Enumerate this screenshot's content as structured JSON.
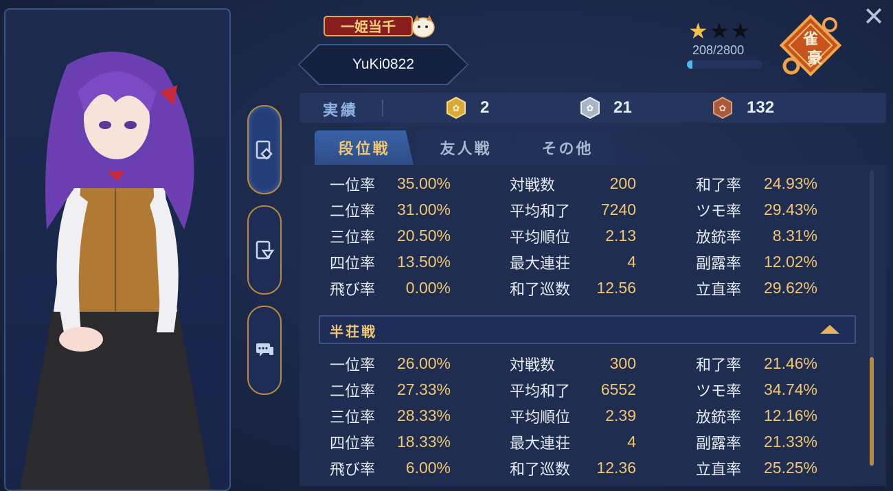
{
  "header": {
    "logo_text": "一姫当千",
    "player_name": "YuKi0822",
    "stars_filled": 1,
    "stars_total": 3,
    "exp_text": "208/2800",
    "exp_progress": 0.074,
    "rank_badge_text": "雀豪",
    "close_glyph": "✕"
  },
  "achievements": {
    "label": "実績",
    "gold": "2",
    "silver": "21",
    "bronze": "132"
  },
  "tabs": [
    {
      "label": "段位戦",
      "active": true
    },
    {
      "label": "友人戦",
      "active": false
    },
    {
      "label": "その他",
      "active": false
    }
  ],
  "section_east": {
    "col1": [
      {
        "label": "一位率",
        "value": "35.00%"
      },
      {
        "label": "二位率",
        "value": "31.00%"
      },
      {
        "label": "三位率",
        "value": "20.50%"
      },
      {
        "label": "四位率",
        "value": "13.50%"
      },
      {
        "label": "飛び率",
        "value": "0.00%"
      }
    ],
    "col2": [
      {
        "label": "対戦数",
        "value": "200"
      },
      {
        "label": "平均和了",
        "value": "7240"
      },
      {
        "label": "平均順位",
        "value": "2.13"
      },
      {
        "label": "最大連荘",
        "value": "4"
      },
      {
        "label": "和了巡数",
        "value": "12.56"
      }
    ],
    "col3": [
      {
        "label": "和了率",
        "value": "24.93%"
      },
      {
        "label": "ツモ率",
        "value": "29.43%"
      },
      {
        "label": "放銃率",
        "value": "8.31%"
      },
      {
        "label": "副露率",
        "value": "12.02%"
      },
      {
        "label": "立直率",
        "value": "29.62%"
      }
    ]
  },
  "section_south": {
    "title": "半荘戦",
    "col1": [
      {
        "label": "一位率",
        "value": "26.00%"
      },
      {
        "label": "二位率",
        "value": "27.33%"
      },
      {
        "label": "三位率",
        "value": "28.33%"
      },
      {
        "label": "四位率",
        "value": "18.33%"
      },
      {
        "label": "飛び率",
        "value": "6.00%"
      }
    ],
    "col2": [
      {
        "label": "対戦数",
        "value": "300"
      },
      {
        "label": "平均和了",
        "value": "6552"
      },
      {
        "label": "平均順位",
        "value": "2.39"
      },
      {
        "label": "最大連荘",
        "value": "4"
      },
      {
        "label": "和了巡数",
        "value": "12.36"
      }
    ],
    "col3": [
      {
        "label": "和了率",
        "value": "21.46%"
      },
      {
        "label": "ツモ率",
        "value": "34.74%"
      },
      {
        "label": "放銃率",
        "value": "12.16%"
      },
      {
        "label": "副露率",
        "value": "21.33%"
      },
      {
        "label": "立直率",
        "value": "25.25%"
      }
    ]
  },
  "colors": {
    "accent_gold": "#f1c670",
    "panel_bg": "#1f2d50",
    "exp_fill": "#4fb8f0"
  }
}
